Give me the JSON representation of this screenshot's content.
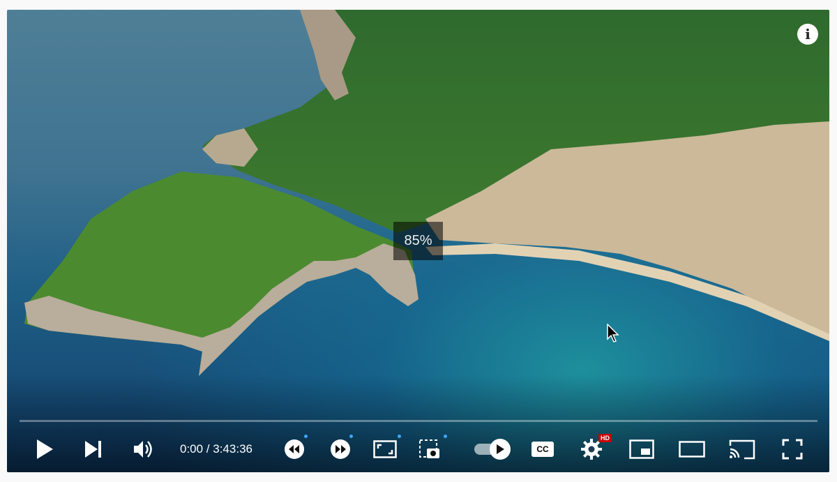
{
  "player": {
    "volume_osd": "85%",
    "time_display": "0:00 / 3:43:36",
    "progress_fraction": 0,
    "hd_badge": "HD",
    "cc_label": "CC",
    "autoplay_on": true
  },
  "colors": {
    "accent_dot": "#3ea6ff",
    "hd_badge": "#cc0000",
    "control_icon": "#ffffff"
  },
  "icons": [
    "info-icon",
    "play-icon",
    "next-icon",
    "volume-icon",
    "rewind-icon",
    "fast-forward-icon",
    "crop-icon",
    "screenshot-icon",
    "autoplay-toggle",
    "captions-icon",
    "settings-icon",
    "miniplayer-icon",
    "theater-icon",
    "cast-icon",
    "fullscreen-icon"
  ]
}
